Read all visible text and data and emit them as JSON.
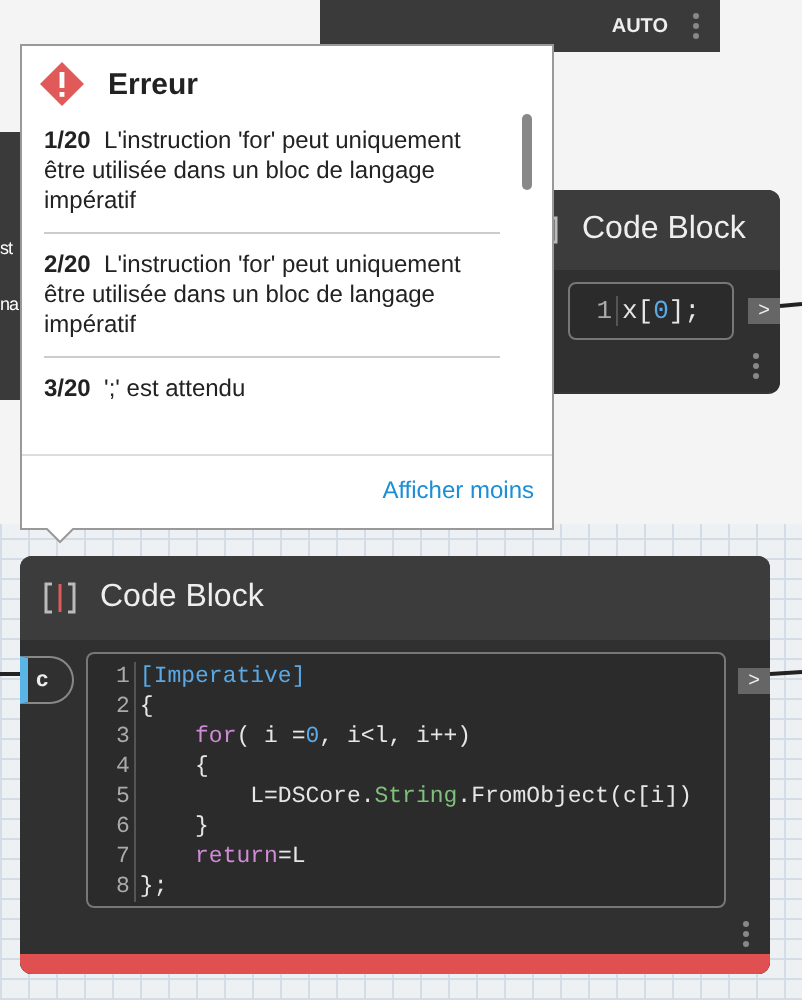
{
  "top_node": {
    "run_mode": "AUTO"
  },
  "left_node": {
    "ports": [
      "st",
      "na"
    ]
  },
  "error_popup": {
    "title": "Erreur",
    "messages": [
      {
        "index": "1/20",
        "text": "L'instruction 'for' peut uniquement être utilisée dans un bloc de langage impératif"
      },
      {
        "index": "2/20",
        "text": "L'instruction 'for' peut uniquement être utilisée dans un bloc de langage impératif"
      },
      {
        "index": "3/20",
        "text": "';' est attendu"
      }
    ],
    "link": "Afficher moins"
  },
  "code_block_small": {
    "title": "Code Block",
    "error": false,
    "output": ">",
    "code_lines": [
      {
        "number": "1",
        "tokens": [
          {
            "text": "x[",
            "kind": "plain"
          },
          {
            "text": "0",
            "kind": "number"
          },
          {
            "text": "];",
            "kind": "plain"
          }
        ]
      }
    ]
  },
  "code_block_main": {
    "title": "Code Block",
    "error": true,
    "input": "c",
    "output": ">",
    "code_lines": [
      {
        "number": "1",
        "tokens": [
          {
            "text": "[Imperative]",
            "kind": "attribute"
          }
        ]
      },
      {
        "number": "2",
        "tokens": [
          {
            "text": "{",
            "kind": "plain"
          }
        ]
      },
      {
        "number": "3",
        "tokens": [
          {
            "text": "    for",
            "kind": "keyword"
          },
          {
            "text": "( i =",
            "kind": "plain"
          },
          {
            "text": "0",
            "kind": "number"
          },
          {
            "text": ", i<l, i++)",
            "kind": "plain"
          }
        ]
      },
      {
        "number": "4",
        "tokens": [
          {
            "text": "    {",
            "kind": "plain"
          }
        ]
      },
      {
        "number": "5",
        "tokens": [
          {
            "text": "        L=DSCore.",
            "kind": "plain"
          },
          {
            "text": "String",
            "kind": "type"
          },
          {
            "text": ".FromObject(c[i])",
            "kind": "plain"
          }
        ]
      },
      {
        "number": "6",
        "tokens": [
          {
            "text": "    }",
            "kind": "plain"
          }
        ]
      },
      {
        "number": "7",
        "tokens": [
          {
            "text": "    return",
            "kind": "keyword"
          },
          {
            "text": "=L",
            "kind": "plain"
          }
        ]
      },
      {
        "number": "8",
        "tokens": [
          {
            "text": "};",
            "kind": "plain"
          }
        ]
      }
    ]
  }
}
